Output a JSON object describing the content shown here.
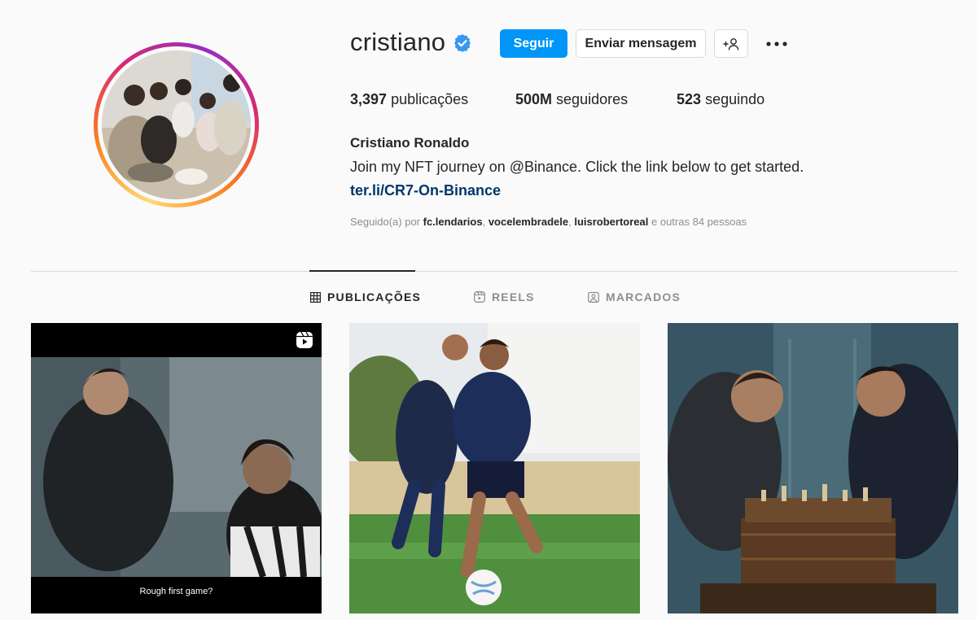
{
  "profile": {
    "username": "cristiano",
    "full_name": "Cristiano Ronaldo",
    "bio": "Join my NFT journey on @Binance. Click the link below to get started.",
    "link": "ter.li/CR7-On-Binance"
  },
  "actions": {
    "follow_label": "Seguir",
    "message_label": "Enviar mensagem"
  },
  "stats": {
    "posts_count": "3,397",
    "posts_label": "publicações",
    "followers_count": "500M",
    "followers_label": "seguidores",
    "following_count": "523",
    "following_label": "seguindo"
  },
  "followed_by": {
    "prefix": "Seguido(a) por",
    "accounts": [
      "fc.lendarios",
      "vocelembradele",
      "luisrobertoreal"
    ],
    "suffix": "e outras 84 pessoas"
  },
  "tabs": [
    {
      "label": "PUBLICAÇÕES",
      "icon": "grid-icon",
      "active": true
    },
    {
      "label": "REELS",
      "icon": "reels-icon",
      "active": false
    },
    {
      "label": "MARCADOS",
      "icon": "tagged-icon",
      "active": false
    }
  ],
  "posts": [
    {
      "type": "reel",
      "caption": "Rough first game?"
    },
    {
      "type": "image",
      "caption": ""
    },
    {
      "type": "image",
      "caption": ""
    }
  ],
  "colors": {
    "accent": "#0095f6",
    "link": "#00376b",
    "verified": "#3897f0",
    "background": "#fafafa"
  }
}
